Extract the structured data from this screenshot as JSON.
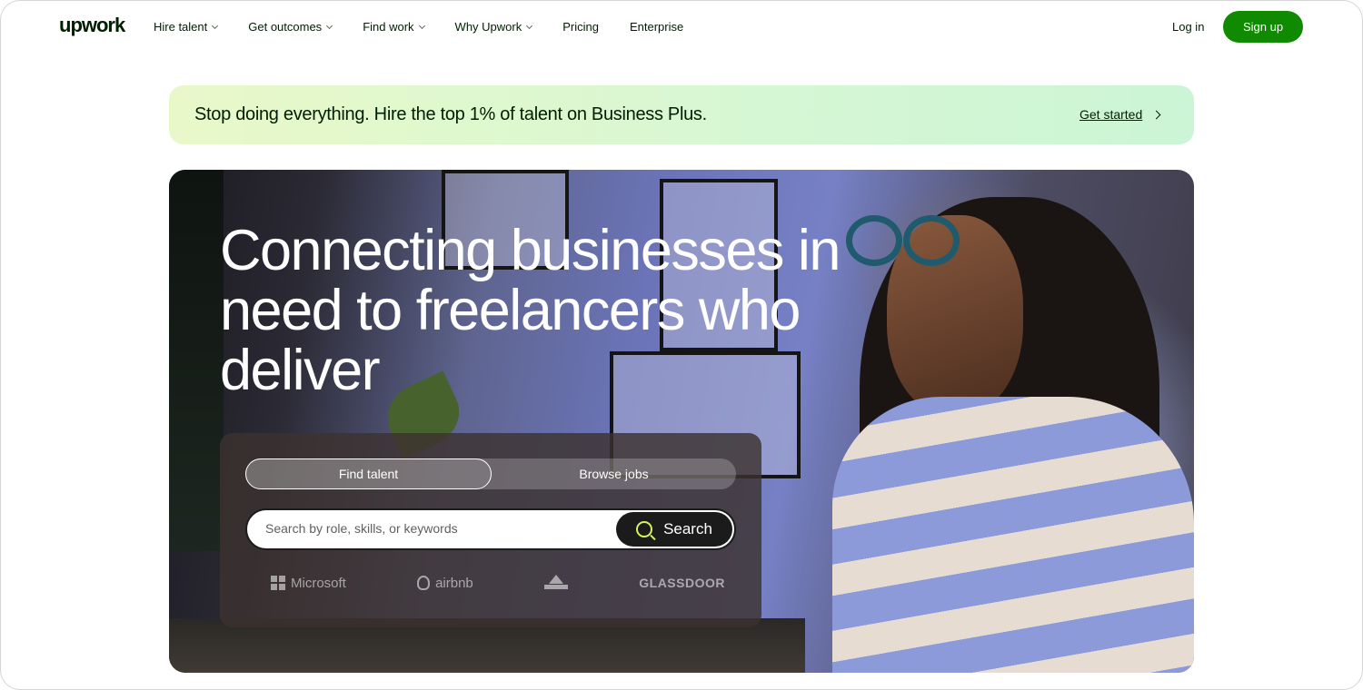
{
  "brand": {
    "logo_text": "upwork",
    "accent": "#108a00"
  },
  "nav": {
    "items": [
      {
        "label": "Hire talent",
        "has_dropdown": true
      },
      {
        "label": "Get outcomes",
        "has_dropdown": true
      },
      {
        "label": "Find work",
        "has_dropdown": true
      },
      {
        "label": "Why Upwork",
        "has_dropdown": true
      },
      {
        "label": "Pricing",
        "has_dropdown": false
      },
      {
        "label": "Enterprise",
        "has_dropdown": false
      }
    ],
    "login_label": "Log in",
    "signup_label": "Sign up"
  },
  "banner": {
    "text": "Stop doing everything. Hire the top 1% of talent on Business Plus.",
    "link_label": "Get started"
  },
  "hero": {
    "title": "Connecting businesses in need to freelancers who deliver",
    "tabs": [
      {
        "label": "Find talent",
        "active": true
      },
      {
        "label": "Browse jobs",
        "active": false
      }
    ],
    "search": {
      "placeholder": "Search by role, skills, or keywords",
      "value": "",
      "button_label": "Search"
    },
    "trusted_logos": [
      "Microsoft",
      "airbnb",
      "BISSELL",
      "GLASSDOOR"
    ]
  },
  "icons": {
    "search": "search-icon",
    "nav_dropdown": "chevron-down-icon",
    "banner_arrow": "chevron-right-icon"
  }
}
